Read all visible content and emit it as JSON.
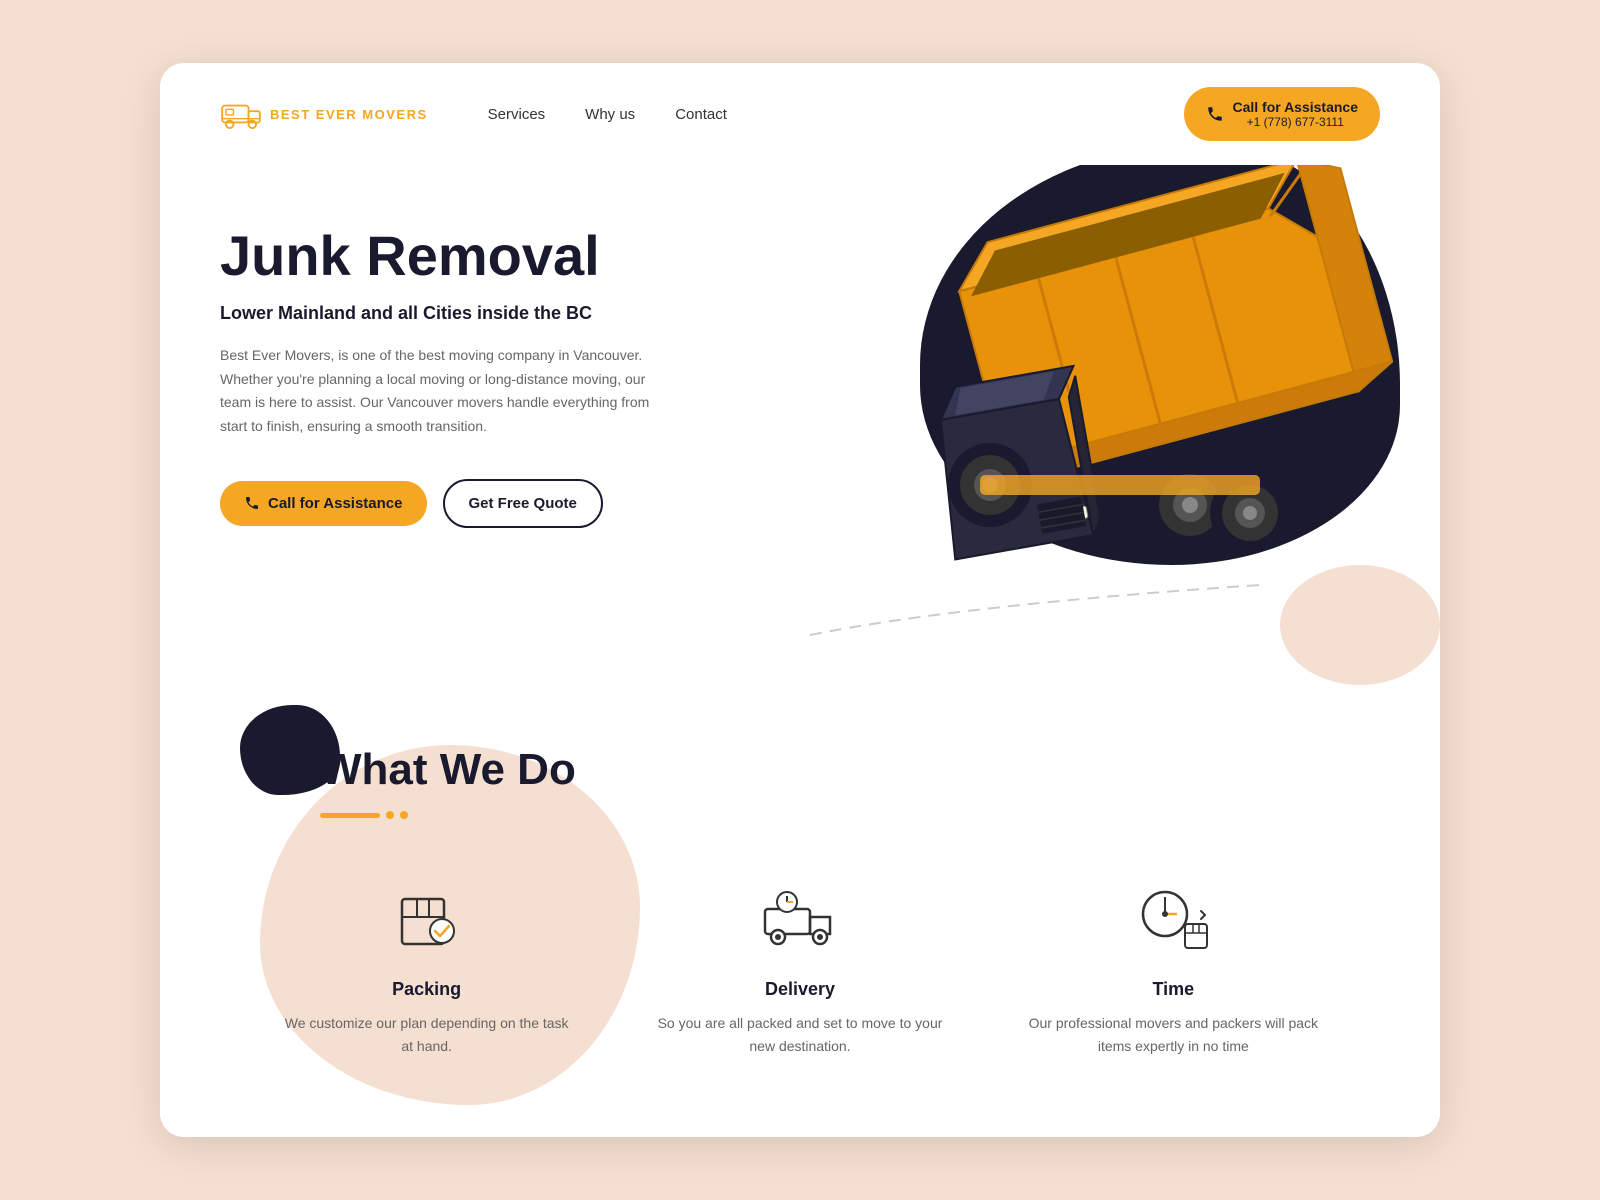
{
  "brand": {
    "name": "BEST EVER MOVERS"
  },
  "nav": {
    "links": [
      {
        "id": "services",
        "label": "Services"
      },
      {
        "id": "why-us",
        "label": "Why us"
      },
      {
        "id": "contact",
        "label": "Contact"
      }
    ],
    "cta_label": "Call for Assistance",
    "cta_phone": "+1 (778) 677-3111"
  },
  "hero": {
    "title": "Junk Removal",
    "subtitle": "Lower Mainland and all Cities inside the BC",
    "description": "Best Ever Movers, is one of the best moving company in Vancouver. Whether you're planning a local moving or long-distance moving, our team is here to assist. Our Vancouver movers handle everything from start to finish, ensuring a smooth transition.",
    "btn_primary": "Call for Assistance",
    "btn_secondary": "Get Free Quote"
  },
  "what_we_do": {
    "title": "What We Do",
    "services": [
      {
        "id": "packing",
        "title": "Packing",
        "description": "We customize our plan depending on the task at hand."
      },
      {
        "id": "delivery",
        "title": "Delivery",
        "description": "So you are all packed and set to move to your new destination."
      },
      {
        "id": "time",
        "title": "Time",
        "description": "Our professional movers and packers will pack items expertly in no time"
      }
    ]
  }
}
